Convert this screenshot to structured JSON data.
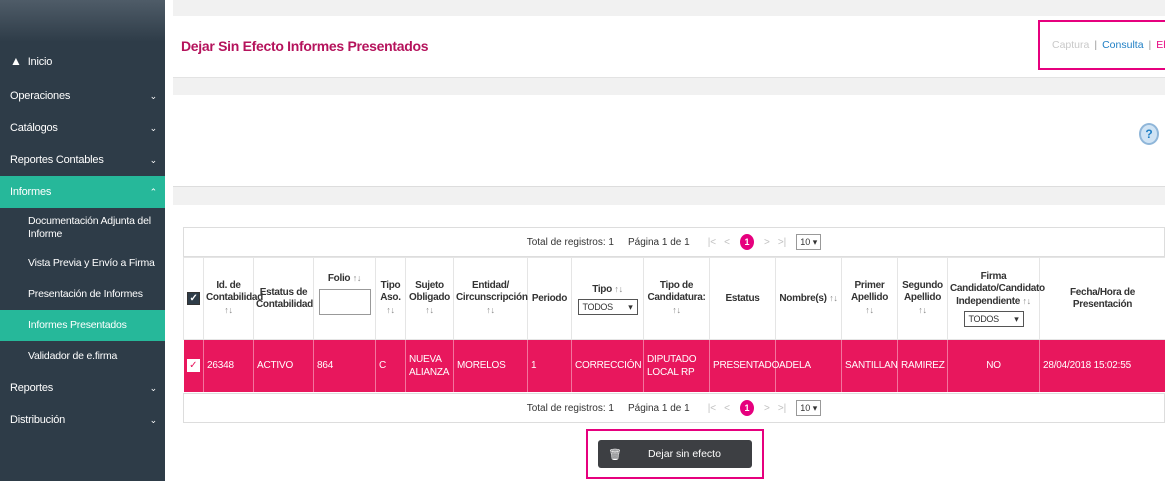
{
  "page_title": "Dejar Sin Efecto Informes Presentados",
  "modes": {
    "captura": "Captura",
    "separator": "|",
    "consulta": "Consulta",
    "eliminar": "Elimin"
  },
  "sidebar": {
    "inicio": "Inicio",
    "operaciones": "Operaciones",
    "catalogos": "Catálogos",
    "reportes_contables": "Reportes Contables",
    "informes": "Informes",
    "sub": {
      "documentacion": "Documentación Adjunta del Informe",
      "vista_previa": "Vista Previa y Envío a Firma",
      "presentacion": "Presentación de Informes",
      "presentados": "Informes Presentados",
      "validador": "Validador de e.firma"
    },
    "reportes": "Reportes",
    "distribucion": "Distribución"
  },
  "pager": {
    "total": "Total de registros: 1",
    "page": "Página 1 de 1",
    "first": "|<",
    "prev": "<",
    "current": "1",
    "next": ">",
    "last": ">|",
    "per_page": "10"
  },
  "table": {
    "headers": {
      "id": "Id. de Contabilidad",
      "estatus_cont": "Estatus de Contabilidad",
      "folio": "Folio",
      "tipo_aso": "Tipo Aso.",
      "sujeto": "Sujeto Obligado",
      "entidad": "Entidad/ Circunscripción",
      "periodo": "Periodo",
      "tipo": "Tipo",
      "tipo_cand": "Tipo de Candidatura:",
      "estatus": "Estatus",
      "nombre": "Nombre(s)",
      "primer": "Primer Apellido",
      "segundo": "Segundo Apellido",
      "firma": "Firma Candidato/Candidato Independiente",
      "fecha": "Fecha/Hora de Presentación"
    },
    "filters": {
      "tipo": "TODOS",
      "firma": "TODOS"
    },
    "sort_glyph": "↑↓",
    "row": {
      "id": "26348",
      "estatus_cont": "ACTIVO",
      "folio": "864",
      "tipo_aso": "C",
      "sujeto": "NUEVA ALIANZA",
      "entidad": "MORELOS",
      "periodo": "1",
      "tipo": "CORRECCIÓN",
      "tipo_cand": "DIPUTADO LOCAL RP",
      "estatus": "PRESENTADO",
      "nombre": "ADELA",
      "primer": "SANTILLAN",
      "segundo": "RAMIREZ",
      "firma": "NO",
      "fecha": "28/04/2018 15:02:55"
    }
  },
  "actions": {
    "dejar_sin_efecto": "Dejar sin efecto"
  },
  "colors": {
    "accent": "#e6007e",
    "row": "#e8175d",
    "sidebar": "#2e3c48",
    "active": "#26b89a"
  }
}
